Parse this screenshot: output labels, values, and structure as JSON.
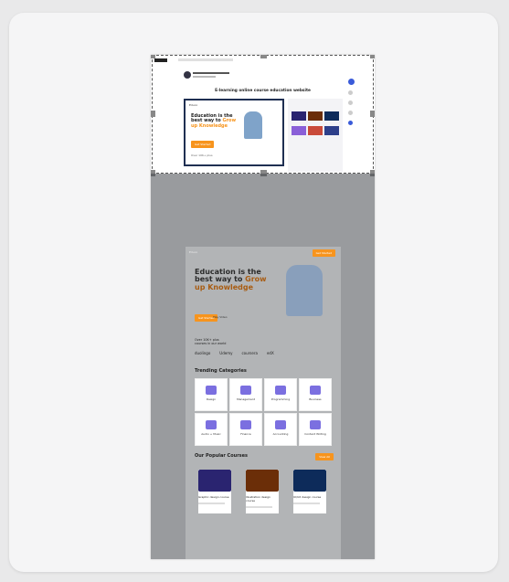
{
  "site": {
    "header_title": "E-learning online course education website",
    "logo": "Educo",
    "nav": [
      "Home",
      "About",
      "Courses",
      "Pages",
      "Contact"
    ],
    "cta": "Get Started"
  },
  "hero": {
    "line1": "Education is the",
    "line2": "best way to ",
    "highlight1": "Grow",
    "line3": "up Knowledge",
    "highlight_color": "#f7941d",
    "button": "Get Started",
    "secondary": "Play Video"
  },
  "partners": {
    "heading": "Over 10K+ plus",
    "subheading": "courses in our world",
    "logos": [
      "duolingo",
      "Udemy",
      "coursera",
      "edX"
    ]
  },
  "categories": {
    "heading": "Trending Categories",
    "items": [
      "Design",
      "Management",
      "Programming",
      "Business",
      "Audio + Music",
      "Finance",
      "Accounting",
      "Content Writing"
    ]
  },
  "courses": {
    "heading": "Our Popular Courses",
    "button": "View All",
    "items": [
      {
        "title": "Graphic design course",
        "color": "#2a2470"
      },
      {
        "title": "Illustration design course",
        "color": "#6b2e08"
      },
      {
        "title": "UI/UX design course",
        "color": "#0d2b5a"
      }
    ]
  }
}
